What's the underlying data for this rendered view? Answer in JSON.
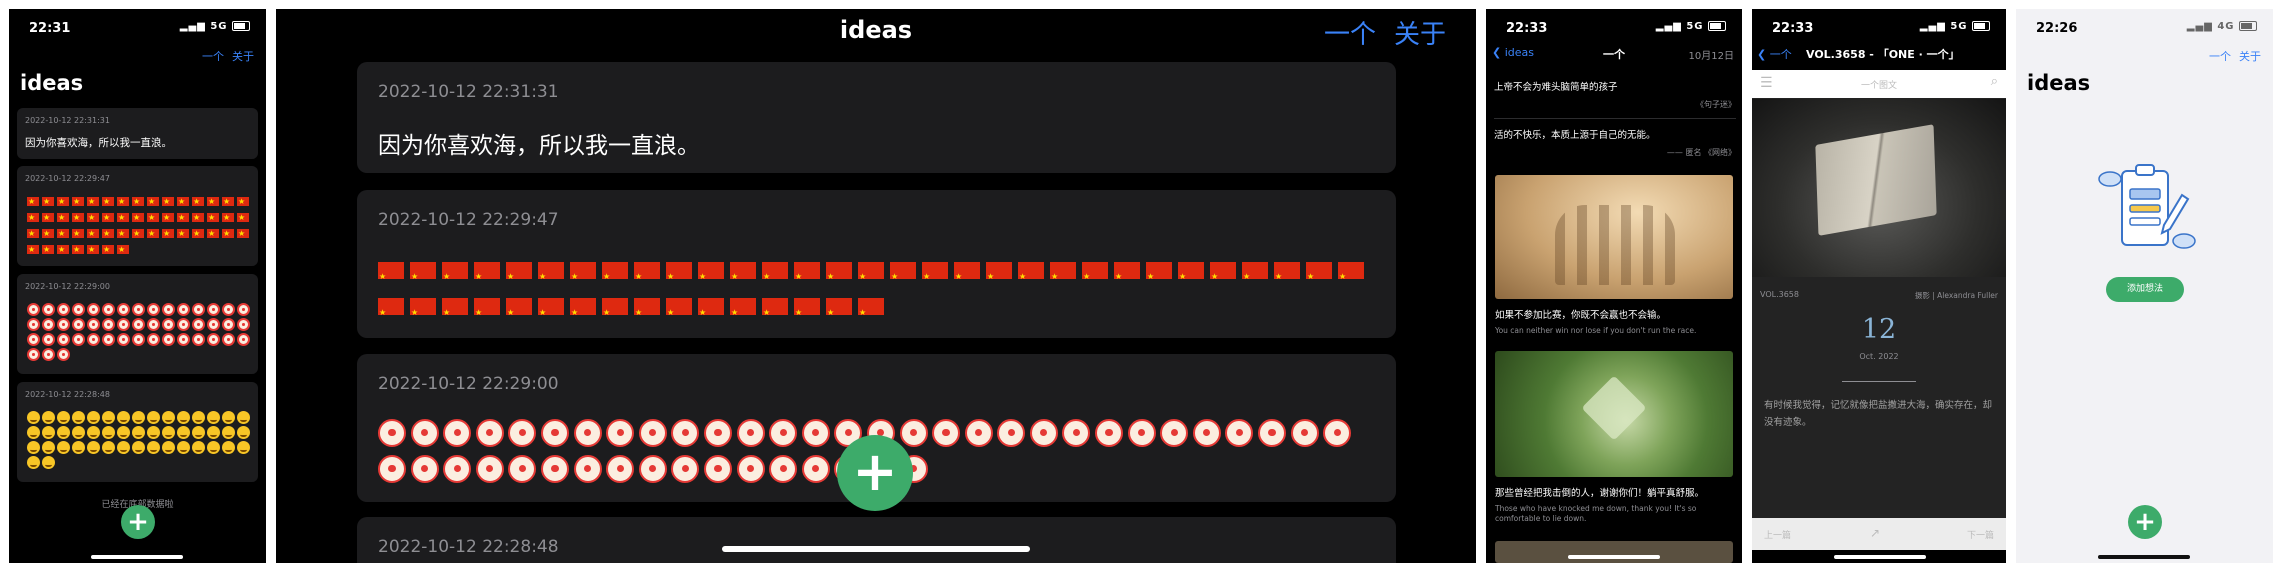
{
  "panel1": {
    "status": {
      "time": "22:31",
      "network": "5G"
    },
    "nav": {
      "one": "一个",
      "about": "关于"
    },
    "title": "ideas",
    "cards": [
      {
        "timestamp": "2022-10-12 22:31:31",
        "text": "因为你喜欢海，所以我一直浪。"
      },
      {
        "timestamp": "2022-10-12 22:29:47",
        "emoji": "flag-cn",
        "count": 52
      },
      {
        "timestamp": "2022-10-12 22:29:00",
        "emoji": "clown",
        "count": 48
      },
      {
        "timestamp": "2022-10-12 22:28:48",
        "emoji": "smile",
        "count": 47
      }
    ],
    "footer": "已经在底部数据啦",
    "fab_label": "+"
  },
  "panel2": {
    "title": "ideas",
    "nav": {
      "one": "一个",
      "about": "关于"
    },
    "cards": [
      {
        "timestamp": "2022-10-12 22:31:31",
        "text": "因为你喜欢海，所以我一直浪。"
      },
      {
        "timestamp": "2022-10-12 22:29:47",
        "emoji": "flag-cn",
        "count": 47
      },
      {
        "timestamp": "2022-10-12 22:29:00",
        "emoji": "clown",
        "count": 47
      },
      {
        "timestamp": "2022-10-12 22:28:48"
      }
    ],
    "fab_label": "+"
  },
  "panel3": {
    "status": {
      "time": "22:33",
      "network": "5G"
    },
    "back_label": "ideas",
    "title": "一个",
    "date": "10月12日",
    "quotes": [
      {
        "text": "上帝不会为难头脑简单的孩子",
        "source": "《句子迷》"
      },
      {
        "text": "活的不快乐，本质上源于自己的无能。",
        "source": "—— 匿名 《网络》"
      }
    ],
    "articles": [
      {
        "title": "如果不参加比赛，你既不会赢也不会输。",
        "subtitle": "You can neither win nor lose if you don't run the race."
      },
      {
        "title": "那些曾经把我击倒的人，谢谢你们！躺平真舒服。",
        "subtitle": "Those who have knocked me down, thank you! It's so comfortable to lie down."
      }
    ],
    "colors": {
      "photo1": "#c9a270",
      "photo2": "#4f7a34"
    }
  },
  "panel4": {
    "status": {
      "time": "22:33",
      "network": "5G"
    },
    "back_label": "一个",
    "title": "VOL.3658 - 「ONE · 一个」",
    "tab_label": "一个图文",
    "vol": "VOL.3658",
    "credit": "摄影 | Alexandra Fuller",
    "day": "12",
    "month_year": "Oct. 2022",
    "quote": "有时候我觉得，记忆就像把盐撒进大海，确实存在，却没有迹象。",
    "bottom": {
      "prev": "上一篇",
      "share": "↗",
      "next": "下一篇"
    }
  },
  "panel5": {
    "status": {
      "time": "22:26",
      "network": "4G"
    },
    "nav": {
      "one": "一个",
      "about": "关于"
    },
    "title": "ideas",
    "add_button": "添加想法",
    "fab_label": "+"
  }
}
